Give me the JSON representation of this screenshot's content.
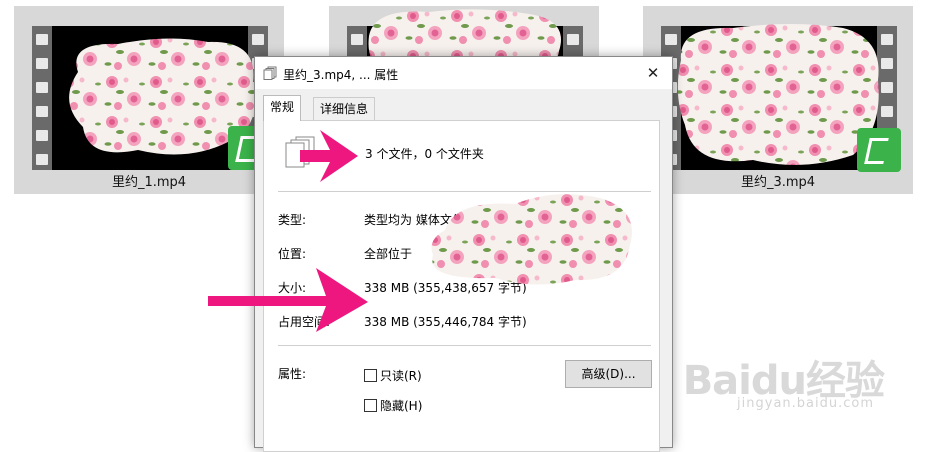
{
  "thumbnails": [
    {
      "label": "里约_1.mp4"
    },
    {
      "label": ""
    },
    {
      "label": "里约_3.mp4"
    }
  ],
  "dialog": {
    "title": "里约_3.mp4, ... 属性",
    "close_glyph": "✕",
    "tabs": [
      {
        "label": "常规",
        "active": true
      },
      {
        "label": "详细信息",
        "active": false
      }
    ],
    "summary": "3 个文件，0 个文件夹",
    "rows": {
      "type_label": "类型:",
      "type_value": "类型均为 媒体文件(.mp4)",
      "location_label": "位置:",
      "location_value": "全部位于",
      "size_label": "大小:",
      "size_value": "338 MB (355,438,657 字节)",
      "disk_label": "占用空间:",
      "disk_value": "338 MB (355,446,784 字节)",
      "attr_label": "属性:"
    },
    "readonly_label": "只读(R)",
    "hidden_label": "隐藏(H)",
    "advanced_label": "高级(D)..."
  },
  "watermark": {
    "brand": "Baidu经验",
    "url": "jingyan.baidu.com"
  },
  "colors": {
    "accent_arrow": "#ee1780",
    "badge": "#3bb34a",
    "thumb_bg": "#d8d8d8"
  },
  "icons": [
    "file-stack-icon",
    "film-strip-icon",
    "arrow-icon",
    "close-icon",
    "app-badge-icon"
  ]
}
